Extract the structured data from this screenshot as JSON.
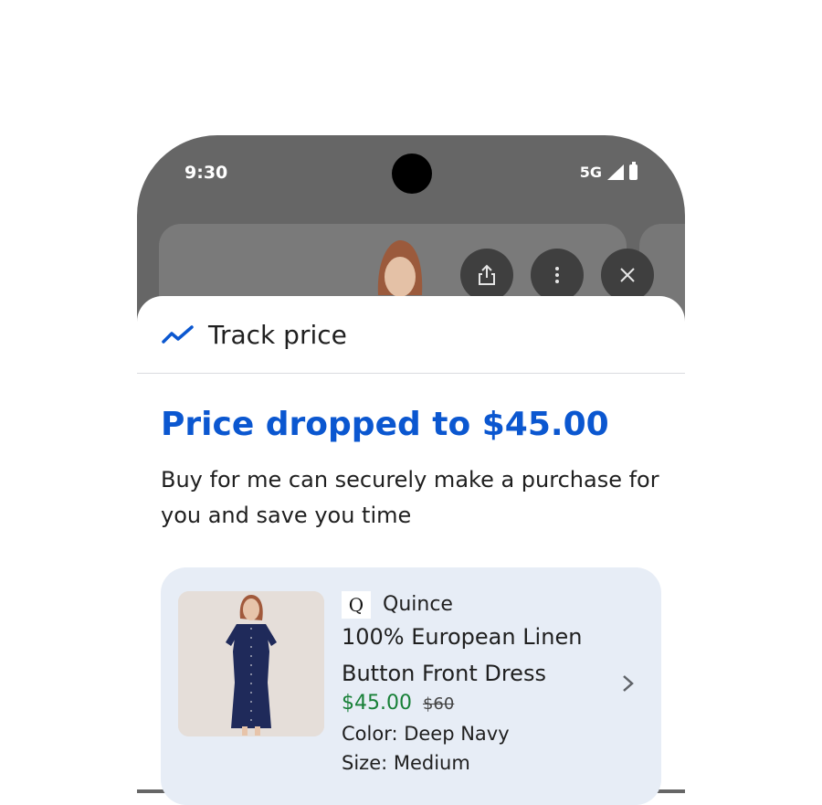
{
  "status": {
    "time": "9:30",
    "network": "5G"
  },
  "icons": {
    "share": "share-icon",
    "more": "more-vert-icon",
    "close": "close-icon",
    "trend": "price-trend-icon",
    "chevron": "chevron-right-icon"
  },
  "sheet": {
    "header_title": "Track price",
    "headline": "Price dropped to $45.00",
    "description": "Buy for me can securely make a purchase for you and save you time"
  },
  "product": {
    "merchant_logo": "Q",
    "merchant": "Quince",
    "title": "100% European Linen Button Front Dress",
    "price": "$45.00",
    "old_price": "$60",
    "color": "Color: Deep Navy",
    "size": "Size: Medium"
  },
  "colors": {
    "accent": "#0b57d0",
    "price_green": "#188038",
    "card_bg": "#e7edf6",
    "overlay": "#666666"
  }
}
